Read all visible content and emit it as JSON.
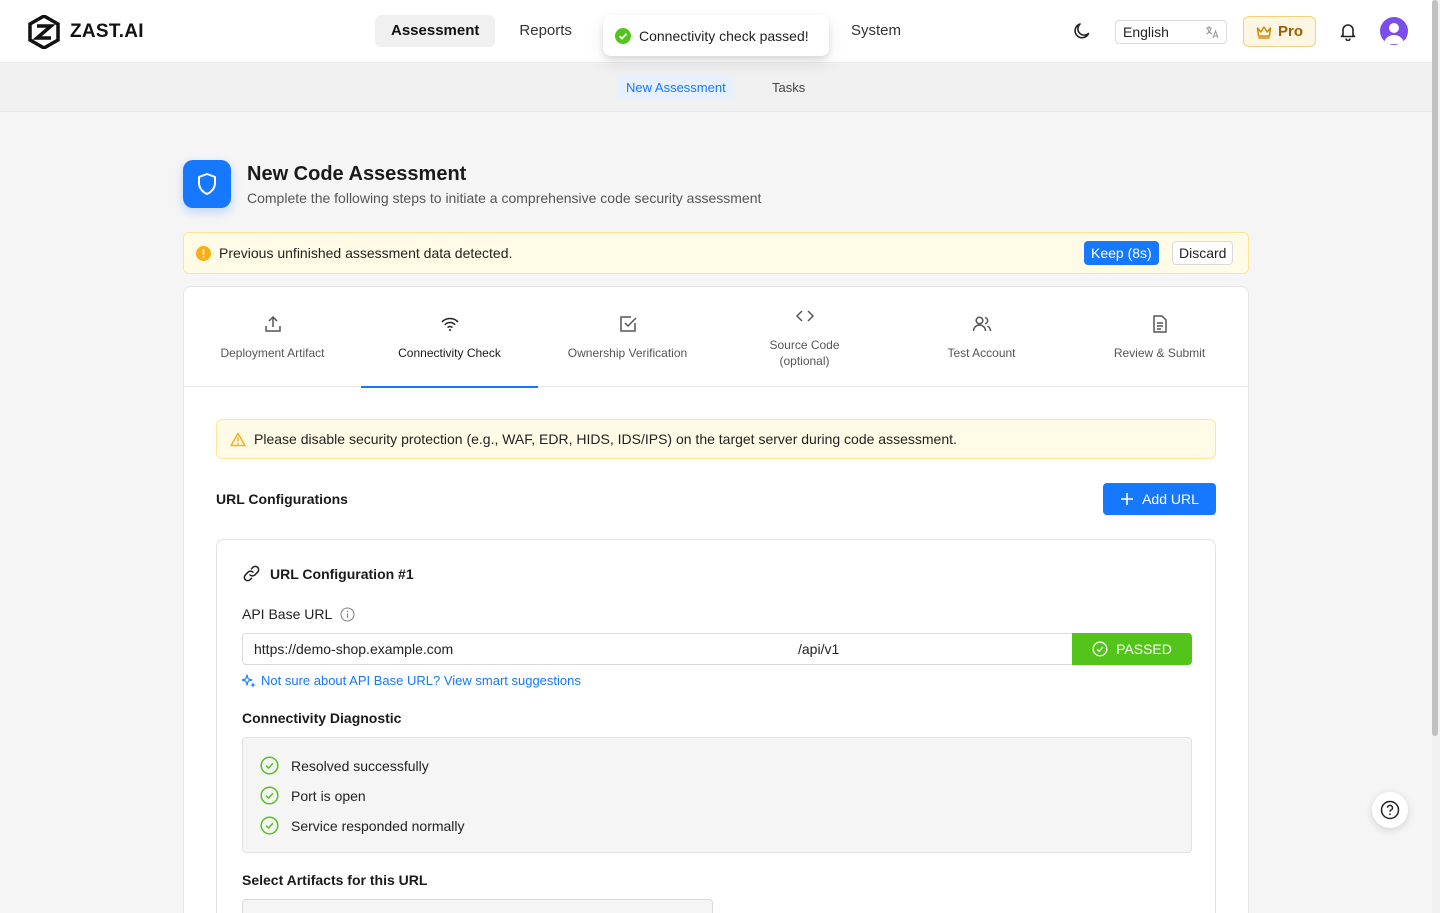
{
  "header": {
    "brand": "ZAST.AI",
    "nav": [
      "Assessment",
      "Reports"
    ],
    "nav_system": "System",
    "toast": "Connectivity check passed!",
    "language": "English",
    "pro_label": "Pro"
  },
  "subnav": {
    "tabs": [
      "New Assessment",
      "Tasks"
    ]
  },
  "page": {
    "title": "New Code Assessment",
    "subtitle": "Complete the following steps to initiate a comprehensive code security assessment"
  },
  "alert": {
    "text": "Previous unfinished assessment data detected.",
    "keep_label": "Keep (8s)",
    "discard_label": "Discard"
  },
  "steps": [
    {
      "label": "Deployment Artifact",
      "icon": "upload-icon"
    },
    {
      "label": "Connectivity Check",
      "icon": "wifi-icon"
    },
    {
      "label": "Ownership Verification",
      "icon": "checkbox-icon"
    },
    {
      "label_line1": "Source Code",
      "label_line2": "(optional)",
      "icon": "code-icon"
    },
    {
      "label": "Test Account",
      "icon": "users-icon"
    },
    {
      "label": "Review & Submit",
      "icon": "document-icon"
    }
  ],
  "warning": "Please disable security protection (e.g., WAF, EDR, HIDS, IDS/IPS) on the target server during code assessment.",
  "url_configs": {
    "title": "URL Configurations",
    "add_label": "Add URL",
    "item": {
      "title": "URL Configuration #1",
      "api_label": "API Base URL",
      "base_url": "https://demo-shop.example.com",
      "path": "/api/v1",
      "status_label": "PASSED",
      "suggest_link": "Not sure about API Base URL? View smart suggestions",
      "diag_title": "Connectivity Diagnostic",
      "diagnostics": [
        "Resolved successfully",
        "Port is open",
        "Service responded normally"
      ],
      "artifacts_title": "Select Artifacts for this URL"
    }
  },
  "colors": {
    "primary": "#1677ff",
    "success": "#52c41a",
    "warning_bg": "#fffbe6",
    "pro_text": "#9a5d00"
  }
}
